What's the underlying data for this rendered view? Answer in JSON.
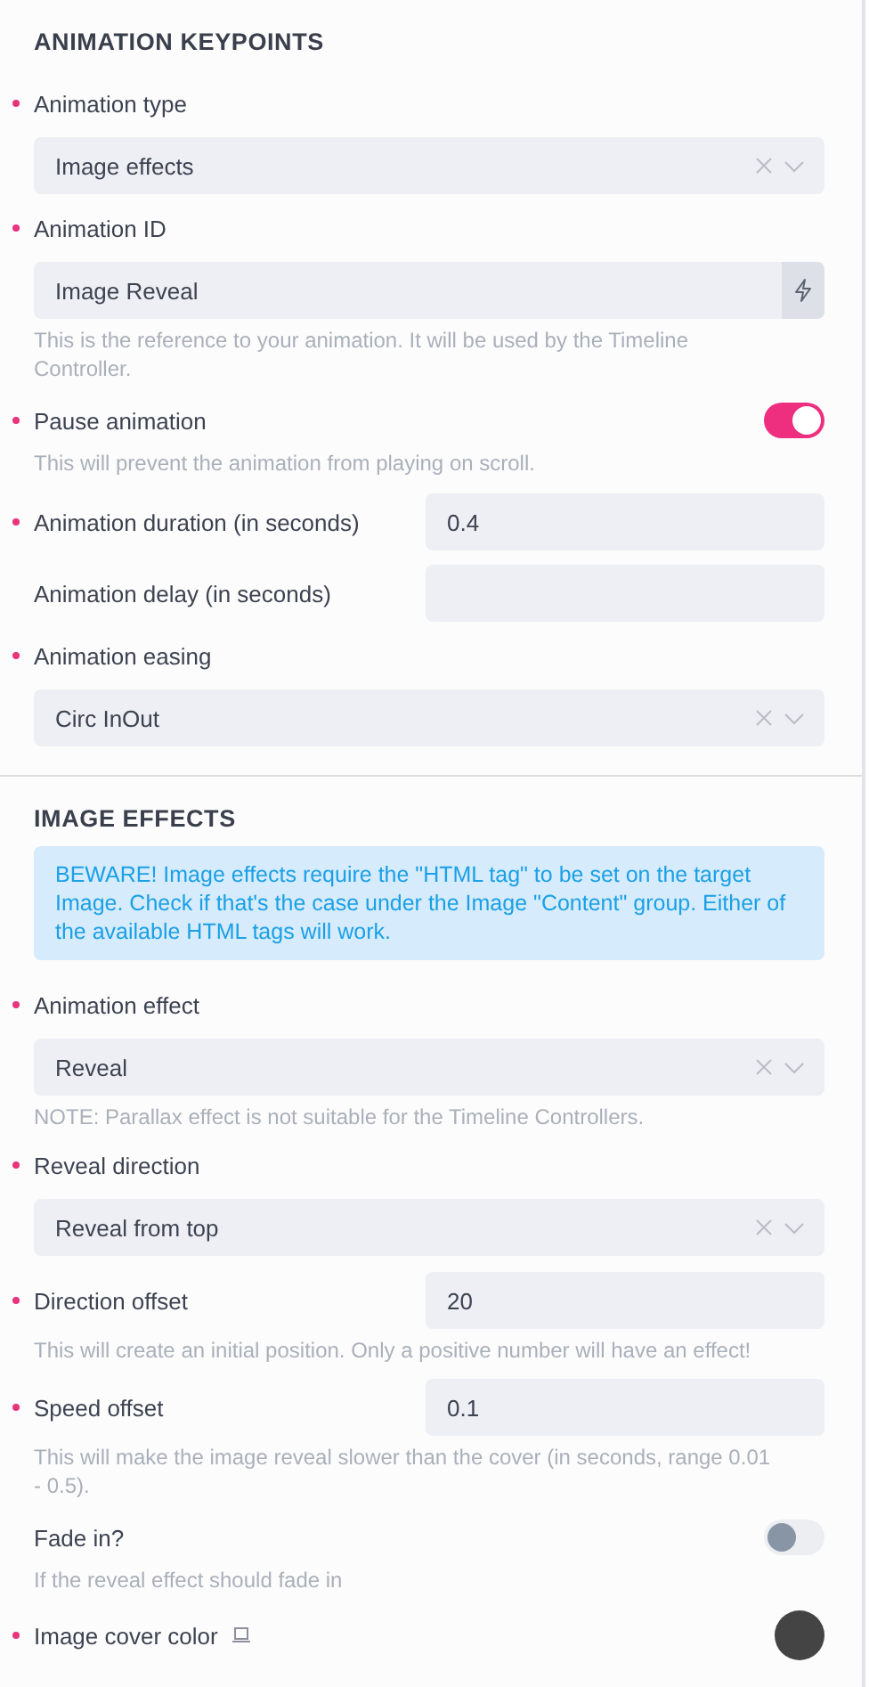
{
  "sections": [
    {
      "title": "ANIMATION KEYPOINTS",
      "fields": [
        {
          "kind": "select",
          "label": "Animation type",
          "required": true,
          "value": "Image effects"
        },
        {
          "kind": "text",
          "label": "Animation ID",
          "required": true,
          "value": "Image Reveal",
          "hint": "This is the reference to your animation. It will be used by the Timeline Controller."
        },
        {
          "kind": "toggle",
          "label": "Pause animation",
          "required": true,
          "on": true,
          "hint": "This will prevent the animation from playing on scroll."
        },
        {
          "kind": "inline",
          "label": "Animation duration (in seconds)",
          "required": true,
          "value": "0.4"
        },
        {
          "kind": "inline",
          "label": "Animation delay (in seconds)",
          "required": false
        },
        {
          "kind": "select",
          "label": "Animation easing",
          "required": true,
          "value": "Circ InOut"
        }
      ]
    },
    {
      "title": "IMAGE EFFECTS",
      "notice": "BEWARE! Image effects require the \"HTML tag\" to be set on the target Image. Check if that's the case under the Image \"Content\" group. Either of the available HTML tags will work.",
      "fields": [
        {
          "kind": "select",
          "label": "Animation effect",
          "required": true,
          "value": "Reveal",
          "hint": "NOTE: Parallax effect is not suitable for the Timeline Controllers."
        },
        {
          "kind": "select",
          "label": "Reveal direction",
          "required": true,
          "value": "Reveal from top"
        },
        {
          "kind": "inline",
          "label": "Direction offset",
          "required": true,
          "value": "20",
          "hint": "This will create an initial position. Only a positive number will have an effect!"
        },
        {
          "kind": "inline",
          "label": "Speed offset",
          "required": true,
          "value": "0.1",
          "hint": "This will make the image reveal slower than the cover (in seconds, range 0.01 - 0.5)."
        },
        {
          "kind": "toggle",
          "label": "Fade in?",
          "required": false,
          "on": false,
          "hint": "If the reveal effect should fade in"
        },
        {
          "kind": "color",
          "label": "Image cover color",
          "required": true,
          "color": "#444444"
        }
      ]
    }
  ]
}
